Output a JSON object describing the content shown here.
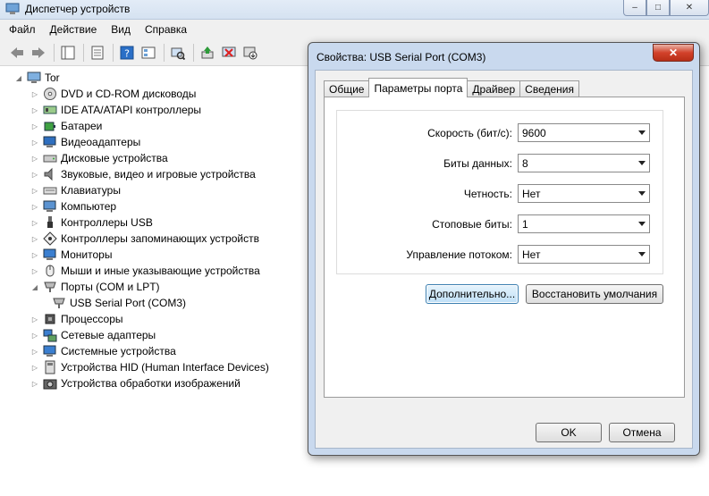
{
  "window": {
    "title": "Диспетчер устройств",
    "controls": [
      "–",
      "□",
      "✕"
    ]
  },
  "menu": [
    "Файл",
    "Действие",
    "Вид",
    "Справка"
  ],
  "toolbar": {
    "icons": [
      "back-icon",
      "forward-icon",
      "show-hide-tree-icon",
      "properties-icon",
      "help-icon",
      "view-icon",
      "scan-hardware-icon",
      "update-driver-icon",
      "disable-device-icon",
      "uninstall-device-icon"
    ]
  },
  "tree": {
    "root": "Tor",
    "items": [
      {
        "label": "DVD и CD-ROM дисководы",
        "icon": "dvd-drive-icon"
      },
      {
        "label": "IDE ATA/ATAPI контроллеры",
        "icon": "ide-controller-icon"
      },
      {
        "label": "Батареи",
        "icon": "battery-icon"
      },
      {
        "label": "Видеоадаптеры",
        "icon": "display-adapter-icon"
      },
      {
        "label": "Дисковые устройства",
        "icon": "disk-drive-icon"
      },
      {
        "label": "Звуковые, видео и игровые устройства",
        "icon": "sound-icon"
      },
      {
        "label": "Клавиатуры",
        "icon": "keyboard-icon"
      },
      {
        "label": "Компьютер",
        "icon": "computer-icon"
      },
      {
        "label": "Контроллеры USB",
        "icon": "usb-icon"
      },
      {
        "label": "Контроллеры запоминающих устройств",
        "icon": "storage-controller-icon"
      },
      {
        "label": "Мониторы",
        "icon": "monitor-icon"
      },
      {
        "label": "Мыши и иные указывающие устройства",
        "icon": "mouse-icon"
      },
      {
        "label": "Порты (COM и LPT)",
        "icon": "port-icon"
      },
      {
        "label": "USB Serial Port (COM3)",
        "icon": "port-icon"
      },
      {
        "label": "Процессоры",
        "icon": "processor-icon"
      },
      {
        "label": "Сетевые адаптеры",
        "icon": "network-adapter-icon"
      },
      {
        "label": "Системные устройства",
        "icon": "system-device-icon"
      },
      {
        "label": "Устройства HID (Human Interface Devices)",
        "icon": "hid-icon"
      },
      {
        "label": "Устройства обработки изображений",
        "icon": "camera-icon"
      }
    ]
  },
  "dialog": {
    "title": "Свойства: USB Serial Port (COM3)",
    "close": "✕",
    "tabs": [
      "Общие",
      "Параметры порта",
      "Драйвер",
      "Сведения"
    ],
    "active_tab": "Параметры порта",
    "fields": [
      {
        "label": "Скорость (бит/с):",
        "value": "9600"
      },
      {
        "label": "Биты данных:",
        "value": "8"
      },
      {
        "label": "Четность:",
        "value": "Нет"
      },
      {
        "label": "Стоповые биты:",
        "value": "1"
      },
      {
        "label": "Управление потоком:",
        "value": "Нет"
      }
    ],
    "advanced_button": "Дополнительно...",
    "restore_button": "Восстановить умолчания",
    "ok_button": "OK",
    "cancel_button": "Отмена"
  },
  "colors": {
    "dialog_frame": "#c9d9ee",
    "focus_button": "#bfe0f7",
    "close_button": "#d2412a"
  }
}
